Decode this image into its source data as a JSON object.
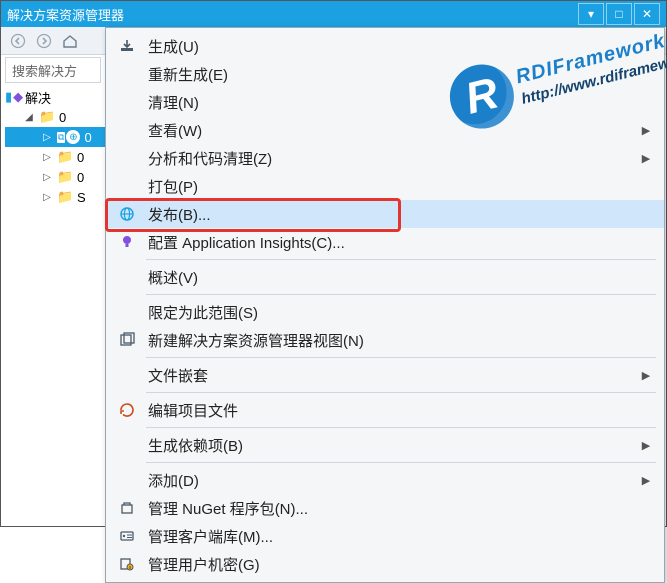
{
  "window": {
    "title": "解决方案资源管理器"
  },
  "search": {
    "placeholder": "搜索解决方"
  },
  "tree": {
    "solution_label": "解决",
    "items": [
      "0",
      "0",
      "0",
      "0",
      "S"
    ]
  },
  "menu": {
    "items": [
      {
        "icon": "build",
        "label": "生成(U)",
        "sub": false
      },
      {
        "icon": "",
        "label": "重新生成(E)",
        "sub": false
      },
      {
        "icon": "",
        "label": "清理(N)",
        "sub": false
      },
      {
        "icon": "",
        "label": "查看(W)",
        "sub": true
      },
      {
        "icon": "",
        "label": "分析和代码清理(Z)",
        "sub": true
      },
      {
        "icon": "",
        "label": "打包(P)",
        "sub": false
      },
      {
        "icon": "globe",
        "label": "发布(B)...",
        "sub": false,
        "highlight": true,
        "boxed": true
      },
      {
        "icon": "bulb",
        "label": "配置 Application Insights(C)...",
        "sub": false
      },
      {
        "sep": true
      },
      {
        "icon": "",
        "label": "概述(V)",
        "sub": false
      },
      {
        "sep": true
      },
      {
        "icon": "",
        "label": "限定为此范围(S)",
        "sub": false
      },
      {
        "icon": "newview",
        "label": "新建解决方案资源管理器视图(N)",
        "sub": false
      },
      {
        "sep": true
      },
      {
        "icon": "",
        "label": "文件嵌套",
        "sub": true
      },
      {
        "sep": true
      },
      {
        "icon": "edit",
        "label": "编辑项目文件",
        "sub": false
      },
      {
        "sep": true
      },
      {
        "icon": "",
        "label": "生成依赖项(B)",
        "sub": true
      },
      {
        "sep": true
      },
      {
        "icon": "",
        "label": "添加(D)",
        "sub": true
      },
      {
        "icon": "nuget",
        "label": "管理 NuGet 程序包(N)...",
        "sub": false
      },
      {
        "icon": "client",
        "label": "管理客户端库(M)...",
        "sub": false
      },
      {
        "icon": "secret",
        "label": "管理用户机密(G)",
        "sub": false
      }
    ]
  },
  "watermark": {
    "brand": "RDIFramework.N",
    "url": "http://www.rdiframework.n"
  }
}
